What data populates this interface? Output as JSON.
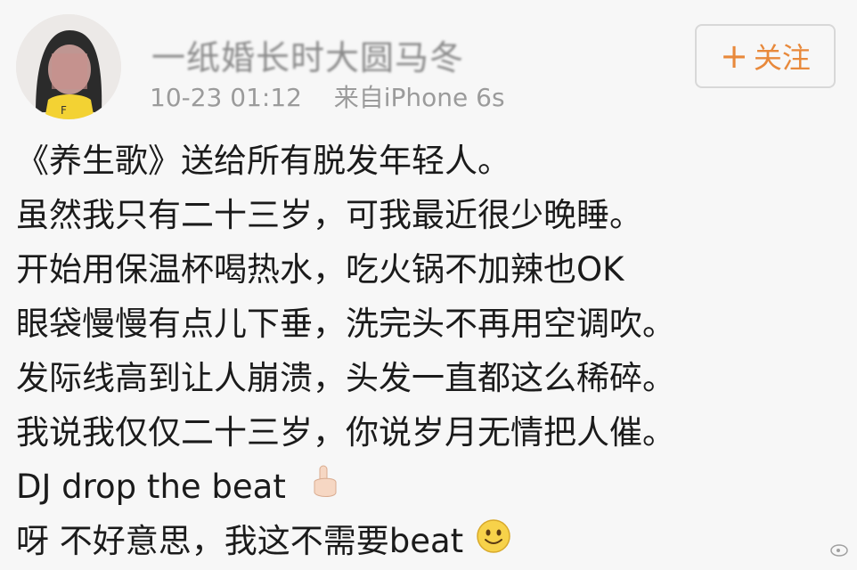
{
  "post": {
    "author": "一纸婚长时大圆马冬",
    "time": "10-23 01:12",
    "source": "来自iPhone 6s",
    "follow_label": "关注"
  },
  "content_lines": [
    "《养生歌》送给所有脱发年轻人。",
    "虽然我只有二十三岁，可我最近很少晚睡。",
    "开始用保温杯喝热水，吃火锅不加辣也OK",
    "眼袋慢慢有点儿下垂，洗完头不再用空调吹。",
    "发际线高到让人崩溃，头发一直都这么稀碎。",
    "我说我仅仅二十三岁，你说岁月无情把人催。",
    "DJ drop the beat",
    "呀 不好意思，我这不需要beat"
  ],
  "emojis": {
    "line7": "pointing-hand-emoji",
    "line8": "smiley-emoji"
  },
  "colors": {
    "follow_accent": "#e8893b",
    "meta": "#9b9b9b"
  }
}
